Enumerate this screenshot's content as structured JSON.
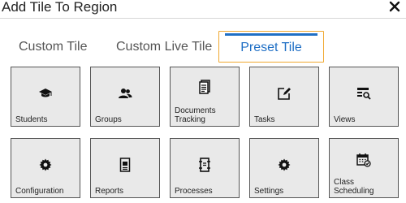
{
  "dialog": {
    "title": "Add Tile To Region",
    "close_label": "×"
  },
  "tabs": [
    {
      "label": "Custom Tile",
      "active": false
    },
    {
      "label": "Custom Live Tile",
      "active": false
    },
    {
      "label": "Preset Tile",
      "active": true
    }
  ],
  "colors": {
    "active_tab_text": "#1f6fc5",
    "active_tab_border": "#f0a830",
    "tile_background": "#e9e9e9",
    "tile_border": "#555555"
  },
  "tiles": [
    {
      "label": "Students",
      "icon": "graduation-cap-icon"
    },
    {
      "label": "Groups",
      "icon": "users-icon"
    },
    {
      "label": "Documents Tracking",
      "icon": "document-list-icon"
    },
    {
      "label": "Tasks",
      "icon": "task-edit-icon"
    },
    {
      "label": "Views",
      "icon": "list-search-icon"
    },
    {
      "label": "Configuration",
      "icon": "gear-icon"
    },
    {
      "label": "Reports",
      "icon": "report-icon"
    },
    {
      "label": "Processes",
      "icon": "process-icon"
    },
    {
      "label": "Settings",
      "icon": "gear-icon"
    },
    {
      "label": "Class Scheduling",
      "icon": "calendar-check-icon"
    }
  ]
}
